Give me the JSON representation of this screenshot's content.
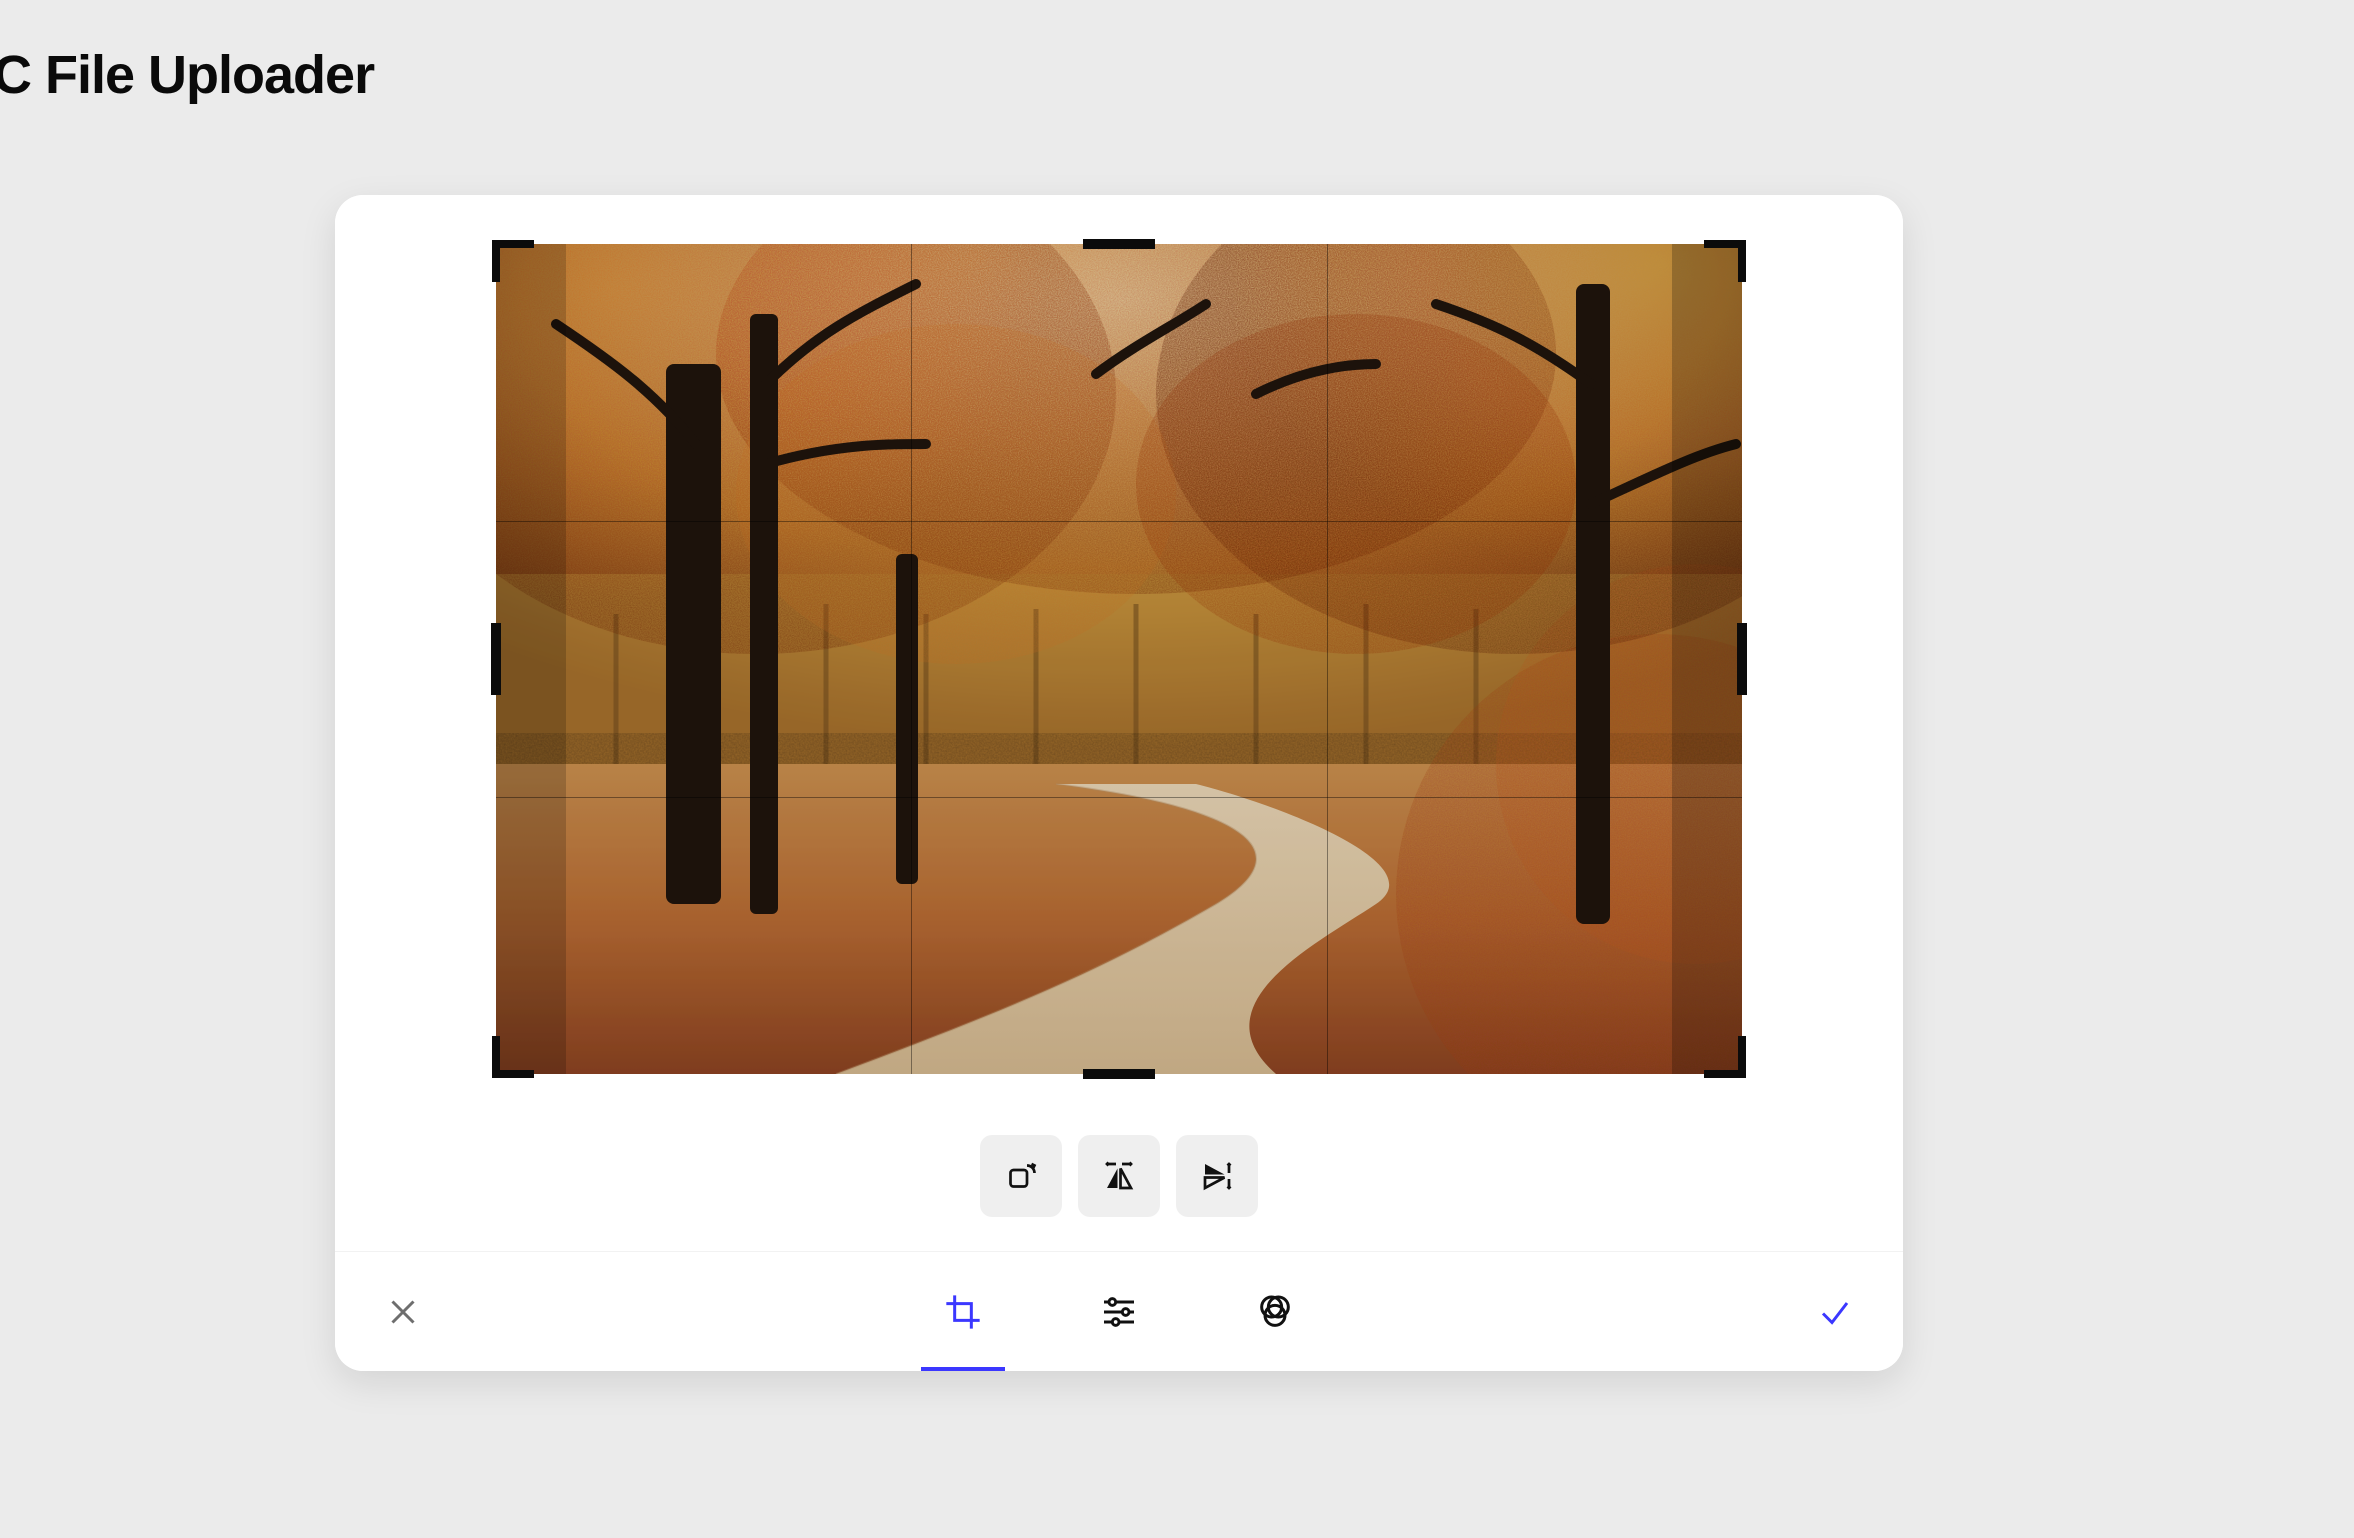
{
  "page": {
    "title": "JC File Uploader"
  },
  "editor": {
    "active_tab": "crop",
    "tabs": {
      "crop": "Crop",
      "tune": "Tune",
      "filters": "Filters"
    },
    "operations": {
      "rotate": "Rotate",
      "mirror_h": "Mirror horizontal",
      "mirror_v": "Flip vertical"
    },
    "actions": {
      "cancel": "Cancel",
      "done": "Done"
    },
    "crop_handles": {
      "tl": "Top-left handle",
      "tr": "Top-right handle",
      "bl": "Bottom-left handle",
      "br": "Bottom-right handle",
      "t": "Top edge handle",
      "b": "Bottom edge handle",
      "l": "Left edge handle",
      "r": "Right edge handle"
    },
    "image": {
      "description": "Autumn forest path with red and orange foliage",
      "grid": "rule-of-thirds"
    }
  },
  "colors": {
    "accent": "#3b37ff",
    "page_bg": "#ebebeb",
    "panel_bg": "#ffffff",
    "button_bg": "#efefef"
  }
}
